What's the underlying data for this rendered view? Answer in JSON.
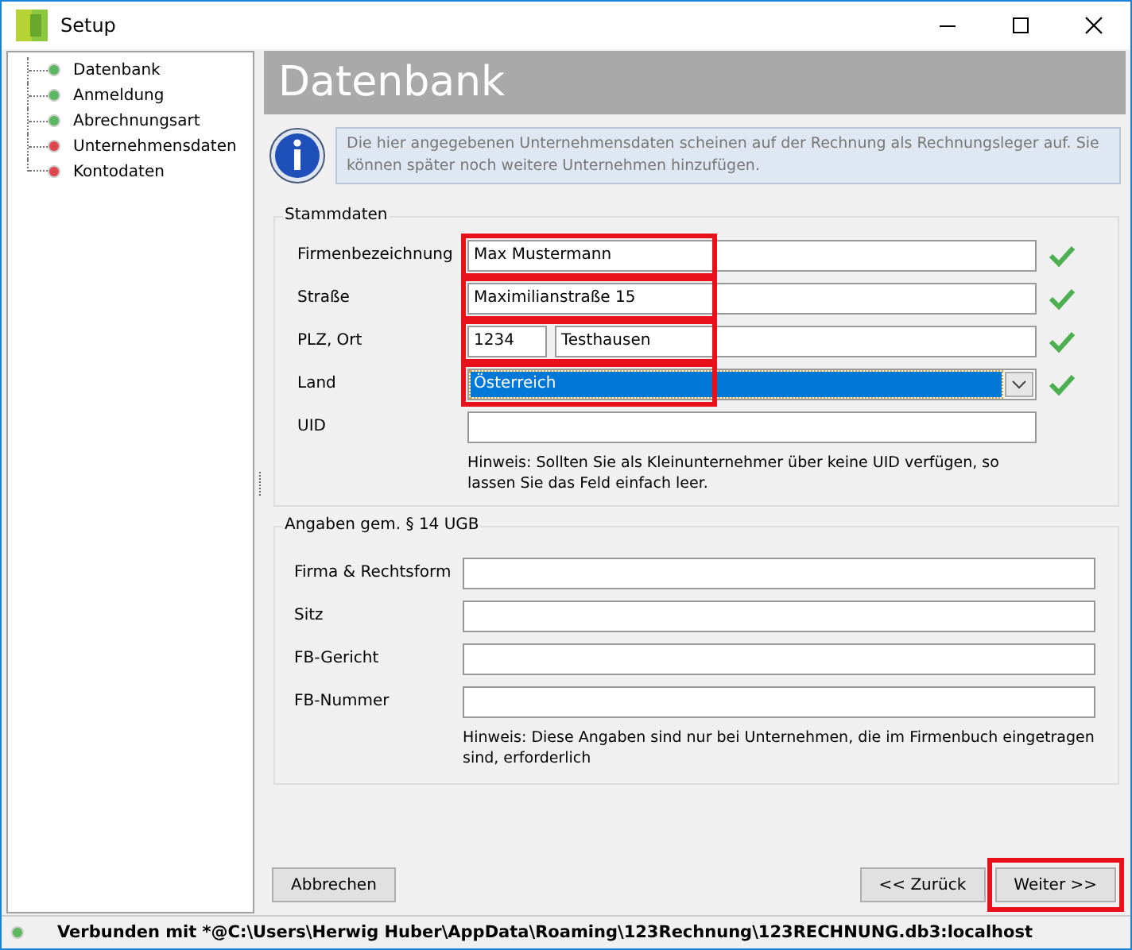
{
  "window": {
    "title": "Setup"
  },
  "sidebar": {
    "items": [
      {
        "label": "Datenbank",
        "color": "#5cb85c"
      },
      {
        "label": "Anmeldung",
        "color": "#5cb85c"
      },
      {
        "label": "Abrechnungsart",
        "color": "#5cb85c"
      },
      {
        "label": "Unternehmensdaten",
        "color": "#e0474c"
      },
      {
        "label": "Kontodaten",
        "color": "#e0474c"
      }
    ]
  },
  "page": {
    "title": "Datenbank",
    "info": "Die hier angegebenen Unternehmensdaten scheinen auf der Rechnung als Rechnungsleger auf. Sie können später noch weitere Unternehmen hinzufügen."
  },
  "stammdaten": {
    "title": "Stammdaten",
    "rows": [
      {
        "kind": "text",
        "label": "Firmenbezeichnung",
        "value": "Max Mustermann",
        "valid": true,
        "highlighted": true
      },
      {
        "kind": "text",
        "label": "Straße",
        "value": "Maximilianstraße 15",
        "valid": true,
        "highlighted": true
      },
      {
        "kind": "pair",
        "label": "PLZ, Ort",
        "value": "1234",
        "value_2": "Testhausen",
        "valid": true,
        "highlighted": true
      },
      {
        "kind": "select",
        "label": "Land",
        "value": "Österreich",
        "valid": true,
        "highlighted": true
      },
      {
        "kind": "text",
        "label": "UID",
        "valid": false,
        "highlighted": false
      }
    ],
    "hint": "Hinweis: Sollten Sie als Kleinunternehmer über keine UID verfügen, so lassen Sie das Feld einfach leer."
  },
  "angaben": {
    "title": "Angaben gem. § 14 UGB",
    "rows": [
      {
        "label": "Firma & Rechtsform"
      },
      {
        "label": "Sitz"
      },
      {
        "label": "FB-Gericht"
      },
      {
        "label": "FB-Nummer"
      }
    ],
    "hint": "Hinweis: Diese Angaben sind nur bei Unternehmen, die im Firmenbuch eingetragen sind, erforderlich"
  },
  "buttons": [
    {
      "label": "Abbrechen",
      "highlighted": false
    },
    {
      "label": "<< Zurück",
      "highlighted": false
    },
    {
      "label": "Weiter >>",
      "highlighted": true
    }
  ],
  "status_bar": {
    "text": "Verbunden mit *@C:\\Users\\Herwig Huber\\AppData\\Roaming\\123Rechnung\\123RECHNUNG.db3:localhost",
    "color": "#5cb85c"
  }
}
